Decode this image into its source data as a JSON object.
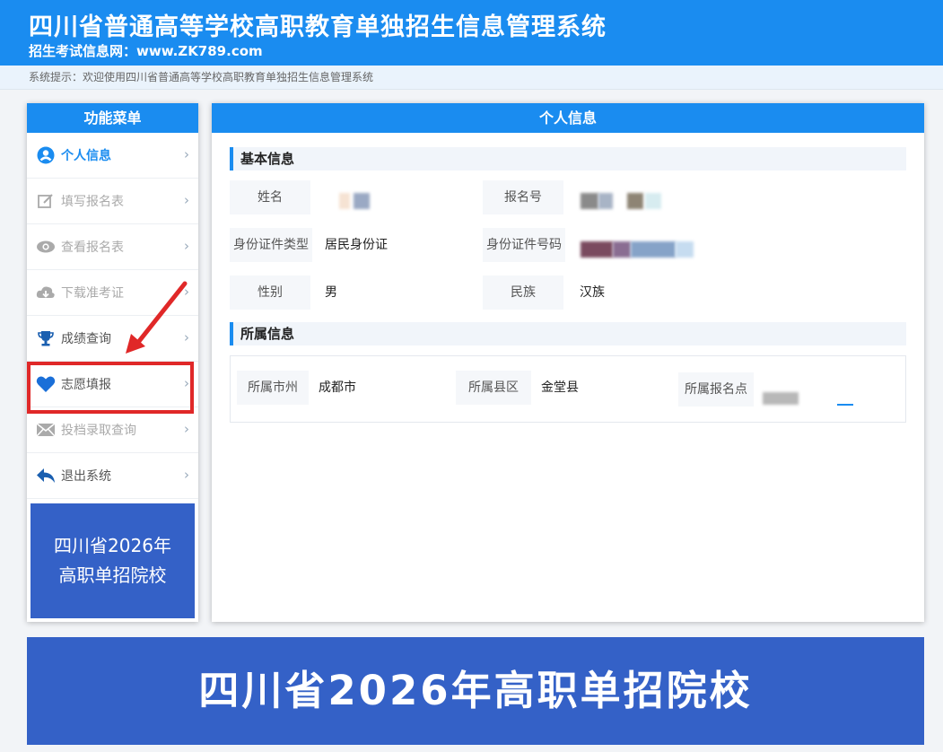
{
  "header": {
    "title": "四川省普通高等学校高职教育单独招生信息管理系统",
    "subtitle": "招生考试信息网：www.ZK789.com"
  },
  "notice": "系统提示：欢迎使用四川省普通高等学校高职教育单独招生信息管理系统",
  "sidebar": {
    "title": "功能菜单",
    "items": [
      {
        "label": "个人信息",
        "icon": "user-circle-icon"
      },
      {
        "label": "填写报名表",
        "icon": "edit-icon"
      },
      {
        "label": "查看报名表",
        "icon": "eye-icon"
      },
      {
        "label": "下载准考证",
        "icon": "cloud-download-icon"
      },
      {
        "label": "成绩查询",
        "icon": "trophy-icon"
      },
      {
        "label": "志愿填报",
        "icon": "heart-icon"
      },
      {
        "label": "投档录取查询",
        "icon": "envelope-icon"
      },
      {
        "label": "退出系统",
        "icon": "reply-icon"
      }
    ],
    "promo_line1": "四川省2026年",
    "promo_line2": "高职单招院校"
  },
  "panel": {
    "title": "个人信息",
    "basic_section": "基本信息",
    "name_label": "姓名",
    "reg_no_label": "报名号",
    "id_type_label": "身份证件类型",
    "id_type_value": "居民身份证",
    "id_no_label": "身份证件号码",
    "gender_label": "性别",
    "gender_value": "男",
    "ethnicity_label": "民族",
    "ethnicity_value": "汉族",
    "region_section": "所属信息",
    "city_label": "所属市州",
    "city_value": "成都市",
    "county_label": "所属县区",
    "county_value": "金堂县",
    "site_label": "所属报名点"
  },
  "footer_banner": "四川省2026年高职单招院校",
  "colors": {
    "primary": "#1a8cf0",
    "banner": "#3461c7",
    "highlight": "#e02828"
  }
}
